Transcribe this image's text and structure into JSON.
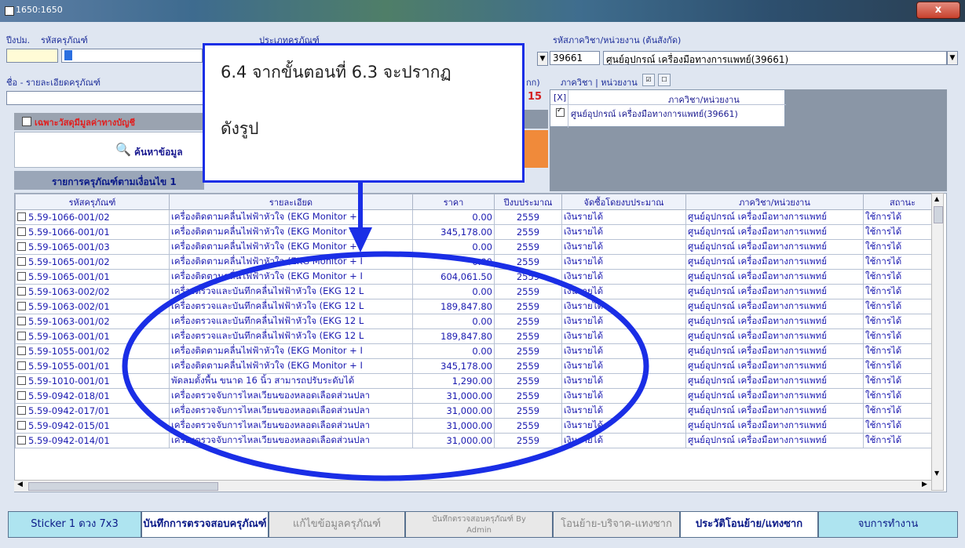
{
  "window": {
    "title": "1650:1650",
    "close_label": "x"
  },
  "header": {
    "fiscal_year_label": "ปีงปม.",
    "asset_code_label": "รหัสครุภัณฑ์",
    "asset_type_label": "ประเภทครุภัณฑ์",
    "dept_code_label": "รหัสภาควิชา/หน่วยงาน (ต้นสังกัด)",
    "dept_code_value": "39661",
    "dept_name_value": "ศูนย์อุปกรณ์ เครื่องมือทางการแพทย์(39661)",
    "name_label": "ชื่อ - รายละเอียดครุภัณฑ์",
    "dept_list_label": "ภาควิชา | หน่วยงาน",
    "partial_label": "กก)",
    "count_fragment": "15",
    "accounting_checkbox_label": "เฉพาะวัสดุมีมูลค่าทางบัญชี",
    "search_button_label": "ค้นหาข้อมูล",
    "list_title": "รายการครุภัณฑ์ตามเงื่อนไข 1"
  },
  "dept_panel": {
    "header_check": "[X]",
    "header_label": "ภาควิชา/หน่วยงาน",
    "rows": [
      {
        "checked": true,
        "name": "ศูนย์อุปกรณ์ เครื่องมือทางการแพทย์(39661)"
      }
    ]
  },
  "callout": {
    "line1": "6.4 จากขั้นตอนที่ 6.3 จะปรากฏ",
    "line2": "ดังรูป"
  },
  "grid": {
    "columns": [
      "รหัสครุภัณฑ์",
      "รายละเอียด",
      "ราคา",
      "ปีงบประมาณ",
      "จัดซื้อโดยงบประมาณ",
      "ภาควิชา/หน่วยงาน",
      "สถานะ"
    ],
    "rows": [
      [
        "5.59-1066-001/02",
        "เครื่องติดตามคลื่นไฟฟ้าหัวใจ (EKG Monitor + I",
        "0.00",
        "2559",
        "เงินรายได้",
        "ศูนย์อุปกรณ์ เครื่องมือทางการแพทย์",
        "ใช้การได้"
      ],
      [
        "5.59-1066-001/01",
        "เครื่องติดตามคลื่นไฟฟ้าหัวใจ (EKG Monitor + I",
        "345,178.00",
        "2559",
        "เงินรายได้",
        "ศูนย์อุปกรณ์ เครื่องมือทางการแพทย์",
        "ใช้การได้"
      ],
      [
        "5.59-1065-001/03",
        "เครื่องติดตามคลื่นไฟฟ้าหัวใจ (EKG Monitor + I",
        "0.00",
        "2559",
        "เงินรายได้",
        "ศูนย์อุปกรณ์ เครื่องมือทางการแพทย์",
        "ใช้การได้"
      ],
      [
        "5.59-1065-001/02",
        "เครื่องติดตามคลื่นไฟฟ้าหัวใจ (EKG Monitor + I",
        "0.00",
        "2559",
        "เงินรายได้",
        "ศูนย์อุปกรณ์ เครื่องมือทางการแพทย์",
        "ใช้การได้"
      ],
      [
        "5.59-1065-001/01",
        "เครื่องติดตามคลื่นไฟฟ้าหัวใจ (EKG Monitor + I",
        "604,061.50",
        "2559",
        "เงินรายได้",
        "ศูนย์อุปกรณ์ เครื่องมือทางการแพทย์",
        "ใช้การได้"
      ],
      [
        "5.59-1063-002/02",
        "เครื่องตรวจและบันทึกคลื่นไฟฟ้าหัวใจ (EKG 12 L",
        "0.00",
        "2559",
        "เงินรายได้",
        "ศูนย์อุปกรณ์ เครื่องมือทางการแพทย์",
        "ใช้การได้"
      ],
      [
        "5.59-1063-002/01",
        "เครื่องตรวจและบันทึกคลื่นไฟฟ้าหัวใจ (EKG 12 L",
        "189,847.80",
        "2559",
        "เงินรายได้",
        "ศูนย์อุปกรณ์ เครื่องมือทางการแพทย์",
        "ใช้การได้"
      ],
      [
        "5.59-1063-001/02",
        "เครื่องตรวจและบันทึกคลื่นไฟฟ้าหัวใจ (EKG 12 L",
        "0.00",
        "2559",
        "เงินรายได้",
        "ศูนย์อุปกรณ์ เครื่องมือทางการแพทย์",
        "ใช้การได้"
      ],
      [
        "5.59-1063-001/01",
        "เครื่องตรวจและบันทึกคลื่นไฟฟ้าหัวใจ (EKG 12 L",
        "189,847.80",
        "2559",
        "เงินรายได้",
        "ศูนย์อุปกรณ์ เครื่องมือทางการแพทย์",
        "ใช้การได้"
      ],
      [
        "5.59-1055-001/02",
        "เครื่องติดตามคลื่นไฟฟ้าหัวใจ (EKG Monitor + I",
        "0.00",
        "2559",
        "เงินรายได้",
        "ศูนย์อุปกรณ์ เครื่องมือทางการแพทย์",
        "ใช้การได้"
      ],
      [
        "5.59-1055-001/01",
        "เครื่องติดตามคลื่นไฟฟ้าหัวใจ (EKG Monitor + I",
        "345,178.00",
        "2559",
        "เงินรายได้",
        "ศูนย์อุปกรณ์ เครื่องมือทางการแพทย์",
        "ใช้การได้"
      ],
      [
        "5.59-1010-001/01",
        "พัดลมตั้งพื้น ขนาด 16 นิ้ว สามารถปรับระดับได้",
        "1,290.00",
        "2559",
        "เงินรายได้",
        "ศูนย์อุปกรณ์ เครื่องมือทางการแพทย์",
        "ใช้การได้"
      ],
      [
        "5.59-0942-018/01",
        "เครื่องตรวจจับการไหลเวียนของหลอดเลือดส่วนปลา",
        "31,000.00",
        "2559",
        "เงินรายได้",
        "ศูนย์อุปกรณ์ เครื่องมือทางการแพทย์",
        "ใช้การได้"
      ],
      [
        "5.59-0942-017/01",
        "เครื่องตรวจจับการไหลเวียนของหลอดเลือดส่วนปลา",
        "31,000.00",
        "2559",
        "เงินรายได้",
        "ศูนย์อุปกรณ์ เครื่องมือทางการแพทย์",
        "ใช้การได้"
      ],
      [
        "5.59-0942-015/01",
        "เครื่องตรวจจับการไหลเวียนของหลอดเลือดส่วนปลา",
        "31,000.00",
        "2559",
        "เงินรายได้",
        "ศูนย์อุปกรณ์ เครื่องมือทางการแพทย์",
        "ใช้การได้"
      ],
      [
        "5.59-0942-014/01",
        "เครื่องตรวจจับการไหลเวียนของหลอดเลือดส่วนปลา",
        "31,000.00",
        "2559",
        "เงินรายได้",
        "ศูนย์อุปกรณ์ เครื่องมือทางการแพทย์",
        "ใช้การได้"
      ]
    ]
  },
  "buttons": {
    "sticker": "Sticker 1 ดวง 7x3",
    "record_check": "บันทึกการตรวจสอบครุภัณฑ์",
    "edit": "แก้ไขข้อมูลครุภัณฑ์",
    "admin_line1": "บันทึกตรวจสอบครุภัณฑ์ By",
    "admin_line2": "Admin",
    "transfer": "โอนย้าย-บริจาค-แทงซาก",
    "history": "ประวัติโอนย้าย/แทงซาก",
    "finish": "จบการทำงาน"
  },
  "colors": {
    "annotation": "#1a2ee6",
    "link_text": "#1a1ab0",
    "accent_orange": "#f08a3a",
    "button_cyan": "#aee4f0"
  }
}
